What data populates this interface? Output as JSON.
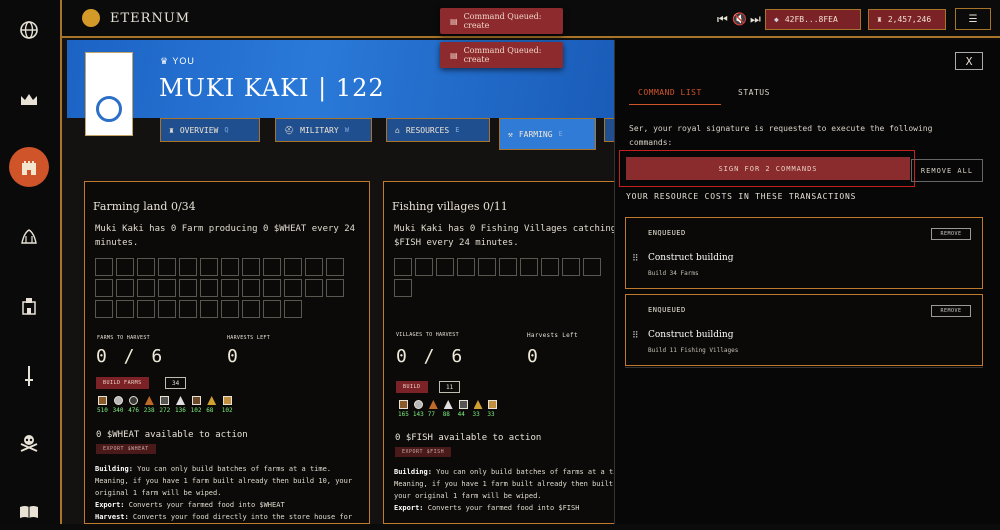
{
  "topbar": {
    "brand": "ETERNUM",
    "toast1": "Command Queued: create",
    "toast2": "Command Queued: create",
    "wallet": "42FB...8FEA",
    "balance": "2,457,246"
  },
  "sidebar": {
    "icons": [
      "globe-icon",
      "crown-icon",
      "castle-icon",
      "bank-icon",
      "barracks-icon",
      "sword-icon",
      "skull-crossbones-icon",
      "book-icon"
    ]
  },
  "profile": {
    "you_label": "YOU",
    "name": "MUKI KAKI | 122"
  },
  "tabs": [
    {
      "label": "OVERVIEW",
      "key": "Q"
    },
    {
      "label": "MILITARY",
      "key": "W"
    },
    {
      "label": "RESOURCES",
      "key": "E"
    },
    {
      "label": "FARMING",
      "key": "E"
    }
  ],
  "farming": {
    "title": "Farming land 0/34",
    "desc": "Muki Kaki has 0 Farm producing 0 $WHEAT every 24 minutes.",
    "label_to_harvest": "FARMS TO HARVEST",
    "label_left": "HARVESTS LEFT",
    "to_harvest": "0 / 6",
    "left": "0",
    "build_label": "BUILD FARMS",
    "build_qty": "34",
    "resources": [
      {
        "icon": "wood-icon",
        "value": "510",
        "color": "#8a5a2a"
      },
      {
        "icon": "stone-icon",
        "value": "340",
        "color": "#b8b8b8"
      },
      {
        "icon": "coal-icon",
        "value": "476",
        "color": "#3a3a3a"
      },
      {
        "icon": "copper-icon",
        "value": "238",
        "color": "#c06a2a"
      },
      {
        "icon": "obsidian-icon",
        "value": "272",
        "color": "#555"
      },
      {
        "icon": "silver-icon",
        "value": "136",
        "color": "#e0e0e0"
      },
      {
        "icon": "ironwood-icon",
        "value": "102",
        "color": "#6a4a2a"
      },
      {
        "icon": "gold-icon",
        "value": "68",
        "color": "#d0a030"
      },
      {
        "icon": "hartwood-icon",
        "value": "102",
        "color": "#c09040"
      }
    ],
    "available": "0 $WHEAT available to action",
    "export_label": "EXPORT $WHEAT",
    "note_building_b": "Building:",
    "note_building": " You can only build batches of farms at a time. Meaning, if you have 1 farm built already then build 10, your original 1 farm will be wiped.",
    "note_export_b": "Export:",
    "note_export": " Converts your farmed food into $WHEAT",
    "note_harvest_b": "Harvest:",
    "note_harvest": " Converts your food directly into the store house for"
  },
  "fishing": {
    "title": "Fishing villages 0/11",
    "desc": "Muki Kaki has 0 Fishing Villages catching 0 $FISH every 24 minutes.",
    "label_to_harvest": "VILLAGES TO HARVEST",
    "label_left": "Harvests Left",
    "to_harvest": "0 / 6",
    "left": "0",
    "build_label": "BUILD",
    "build_qty": "11",
    "resources": [
      {
        "icon": "wood-icon",
        "value": "165",
        "color": "#8a5a2a"
      },
      {
        "icon": "stone-icon",
        "value": "143",
        "color": "#b8b8b8"
      },
      {
        "icon": "copper-icon",
        "value": "77",
        "color": "#c06a2a"
      },
      {
        "icon": "silver-icon",
        "value": "88",
        "color": "#e0e0e0"
      },
      {
        "icon": "obsidian-icon",
        "value": "44",
        "color": "#555"
      },
      {
        "icon": "gold-icon",
        "value": "33",
        "color": "#d0a030"
      },
      {
        "icon": "hartwood-icon",
        "value": "33",
        "color": "#c09040"
      }
    ],
    "available": "0 $FISH available to action",
    "export_label": "EXPORT $FISH",
    "note_building_b": "Building:",
    "note_building": " You can only build batches of farms at a ti",
    "note_meaning": "Meaning, if you have 1 farm built already then built",
    "note_wiped": "your original 1 farm will be wiped.",
    "note_export_b": "Export:",
    "note_export": " Converts your farmed food into $FISH"
  },
  "command_panel": {
    "close": "X",
    "tab_list": "COMMAND LIST",
    "tab_status": "STATUS",
    "ask": "Ser, your royal signature is requested to execute the following commands:",
    "sign_label": "SIGN FOR 2 COMMANDS",
    "remove_all": "REMOVE ALL",
    "costs_heading": "YOUR RESOURCE COSTS IN THESE TRANSACTIONS",
    "queue": [
      {
        "status": "ENQUEUED",
        "remove": "REMOVE",
        "title": "Construct building",
        "sub": "Build 34 Farms"
      },
      {
        "status": "ENQUEUED",
        "remove": "REMOVE",
        "title": "Construct building",
        "sub": "Build 11 Fishing Villages"
      }
    ]
  }
}
